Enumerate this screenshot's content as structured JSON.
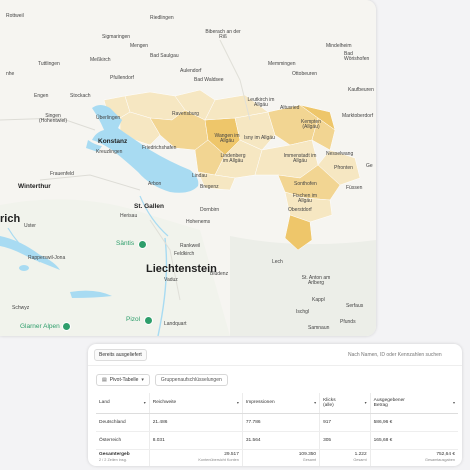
{
  "map": {
    "places": {
      "rottweil": "Rottweil",
      "riedlingen": "Riedlingen",
      "biberach": "Biberach an der Riß",
      "sigmaringen": "Sigmaringen",
      "mengen": "Mengen",
      "bad_saulgau": "Bad Saulgau",
      "mindelheim": "Mindelheim",
      "bad_woerishofen": "Bad Wörishofen",
      "tuttlingen": "Tuttlingen",
      "messkirch": "Meßkirch",
      "pfullendorf": "Pfullendorf",
      "aulendorf": "Aulendorf",
      "bad_waldsee": "Bad Waldsee",
      "memmingen": "Memmingen",
      "ottobeuren": "Ottobeuren",
      "kaufbeuren": "Kaufbeuren",
      "engen": "Engen",
      "stockach": "Stockach",
      "singen": "Singen (Hohentwiel)",
      "ueberlingen": "Überlingen",
      "ravensburg": "Ravensburg",
      "leutkirch": "Leutkirch im Allgäu",
      "altusried": "Altusried",
      "kempten": "Kempten (Allgäu)",
      "marktoberdorf": "Marktoberdorf",
      "konstanz": "Konstanz",
      "kreuzlingen": "Kreuzlingen",
      "friedrichshafen": "Friedrichshafen",
      "wangen": "Wangen im Allgäu",
      "isny": "Isny im Allgäu",
      "nesselwang": "Nesselwang",
      "pfronten": "Pfronten",
      "lindenberg": "Lindenberg im Allgäu",
      "immenstadt": "Immenstadt im Allgäu",
      "lindau": "Lindau",
      "frauenfeld": "Frauenfeld",
      "arbon": "Arbon",
      "bregenz": "Bregenz",
      "sonthofen": "Sonthofen",
      "fuessen": "Füssen",
      "winterthur": "Winterthur",
      "fischen": "Fischen im Allgäu",
      "oberstdorf": "Oberstdorf",
      "st_gallen": "St. Gallen",
      "herisau": "Herisau",
      "dornbirn": "Dornbirn",
      "hohenems": "Hohenems",
      "zurich_fragment": "rich",
      "uster": "Uster",
      "saentis": "Säntis",
      "rankweil": "Rankweil",
      "feldkirch": "Feldkirch",
      "rapperswil": "Rapperswil-Jona",
      "liechtenstein": "Liechtenstein",
      "lech": "Lech",
      "vaduz": "Vaduz",
      "st_anton": "St. Anton am Arlberg",
      "bludenz": "Bludenz",
      "schwyz": "Schwyz",
      "kappl": "Kappl",
      "serfaus": "Serfaus",
      "pizol": "Pizol",
      "ischgl": "Ischgl",
      "pfunds": "Pfunds",
      "glarner_alpen": "Glarner Alpen",
      "landquart": "Landquart",
      "samnaun": "Samnaun",
      "nhe": "nhe",
      "ge": "Ge"
    }
  },
  "panel": {
    "delivered_chip": "Bereits ausgeliefert",
    "search_placeholder": "Nach Namen, ID oder Kennzahlen suchen",
    "pivot_label": "Pivot-Tabelle",
    "group_label": "Gruppenaufschlüsselungen"
  },
  "table": {
    "headers": [
      "Land",
      "Reichweite",
      "Impressionen",
      "Klicks (alle)",
      "Ausgegebener Betrag"
    ],
    "rows": [
      [
        "Deutschland",
        "21.486",
        "77.786",
        "917",
        "586,96 €"
      ],
      [
        "Österreich",
        "8.031",
        "31.564",
        "305",
        "165,68 €"
      ]
    ],
    "footer": {
      "title": "Gesamtergeb",
      "subtitle": "2 / 2 Zeilen insg.",
      "reach": "29.517",
      "reach_sub": "Kontenübersicht Konten",
      "impressions": "109.350",
      "impressions_sub": "Gesamt",
      "clicks": "1.222",
      "clicks_sub": "Gesamt",
      "amount": "752,64 €",
      "amount_sub": "Gesamtausgaben"
    }
  },
  "colors": {
    "water": "#a8dbf2",
    "region_light": "#f6e7c2",
    "region_mid": "#f2d592",
    "region_dark": "#eec66a",
    "poi_green": "#2e9e6b"
  }
}
